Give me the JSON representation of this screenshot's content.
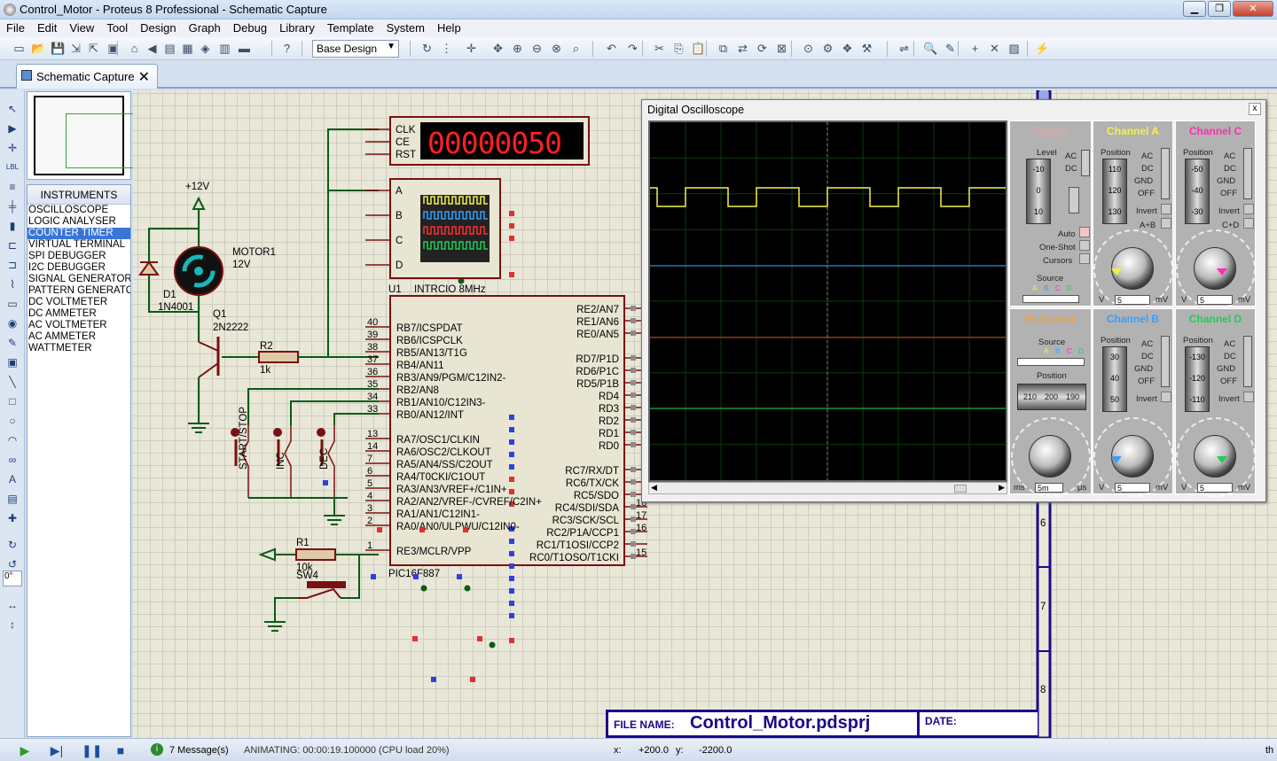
{
  "window": {
    "title": "Control_Motor - Proteus 8 Professional - Schematic Capture"
  },
  "menu": [
    "File",
    "Edit",
    "View",
    "Tool",
    "Design",
    "Graph",
    "Debug",
    "Library",
    "Template",
    "System",
    "Help"
  ],
  "toolbar": {
    "design_select": "Base Design"
  },
  "tab": {
    "label": "Schematic Capture"
  },
  "left_tools": {
    "zoom_value": "0°"
  },
  "instruments": {
    "header": "INSTRUMENTS",
    "items": [
      "OSCILLOSCOPE",
      "LOGIC ANALYSER",
      "COUNTER TIMER",
      "VIRTUAL TERMINAL",
      "SPI DEBUGGER",
      "I2C DEBUGGER",
      "SIGNAL GENERATOR",
      "PATTERN GENERATO",
      "DC VOLTMETER",
      "DC AMMETER",
      "AC VOLTMETER",
      "AC AMMETER",
      "WATTMETER"
    ],
    "selected": "COUNTER TIMER"
  },
  "schematic": {
    "supply": "+12V",
    "motor_ref": "MOTOR1",
    "motor_val": "12V",
    "diode_ref": "D1",
    "diode_val": "1N4001",
    "transistor_ref": "Q1",
    "transistor_val": "2N2222",
    "r2_ref": "R2",
    "r2_val": "1k",
    "r1_ref": "R1",
    "r1_val": "10k",
    "sw4_ref": "SW4",
    "btn_start": "START/STOP",
    "btn_inc": "INC",
    "btn_dec": "DEC",
    "counter_pins": [
      "CLK",
      "CE",
      "RST"
    ],
    "counter_display": "00000050",
    "logic_pins": [
      "A",
      "B",
      "C",
      "D"
    ],
    "mcu_ref": "U1",
    "mcu_clock": "INTRCIO 8MHz",
    "mcu_part": "PIC16F887",
    "mcu_left": [
      {
        "num": "40",
        "name": "RB7/ICSPDAT"
      },
      {
        "num": "39",
        "name": "RB6/ICSPCLK"
      },
      {
        "num": "38",
        "name": "RB5/AN13/T1G"
      },
      {
        "num": "37",
        "name": "RB4/AN11"
      },
      {
        "num": "36",
        "name": "RB3/AN9/PGM/C12IN2-"
      },
      {
        "num": "35",
        "name": "RB2/AN8"
      },
      {
        "num": "34",
        "name": "RB1/AN10/C12IN3-"
      },
      {
        "num": "33",
        "name": "RB0/AN12/INT"
      },
      {
        "num": "13",
        "name": "RA7/OSC1/CLKIN"
      },
      {
        "num": "14",
        "name": "RA6/OSC2/CLKOUT"
      },
      {
        "num": "7",
        "name": "RA5/AN4/SS/C2OUT"
      },
      {
        "num": "6",
        "name": "RA4/T0CKI/C1OUT"
      },
      {
        "num": "5",
        "name": "RA3/AN3/VREF+/C1IN+"
      },
      {
        "num": "4",
        "name": "RA2/AN2/VREF-/CVREF/C2IN+"
      },
      {
        "num": "3",
        "name": "RA1/AN1/C12IN1-"
      },
      {
        "num": "2",
        "name": "RA0/AN0/ULPWU/C12IN0-"
      },
      {
        "num": "1",
        "name": "RE3/MCLR/VPP"
      }
    ],
    "mcu_right": [
      {
        "num": "",
        "name": "RE2/AN7"
      },
      {
        "num": "",
        "name": "RE1/AN6"
      },
      {
        "num": "",
        "name": "RE0/AN5"
      },
      {
        "num": "",
        "name": "RD7/P1D"
      },
      {
        "num": "",
        "name": "RD6/P1C"
      },
      {
        "num": "",
        "name": "RD5/P1B"
      },
      {
        "num": "",
        "name": "RD4"
      },
      {
        "num": "",
        "name": "RD3"
      },
      {
        "num": "",
        "name": "RD2"
      },
      {
        "num": "",
        "name": "RD1"
      },
      {
        "num": "",
        "name": "RD0"
      },
      {
        "num": "",
        "name": "RC7/RX/DT"
      },
      {
        "num": "",
        "name": "RC6/TX/CK"
      },
      {
        "num": "",
        "name": "RC5/SDO"
      },
      {
        "num": "18",
        "name": "RC4/SDI/SDA"
      },
      {
        "num": "17",
        "name": "RC3/SCK/SCL"
      },
      {
        "num": "16",
        "name": "RC2/P1A/CCP1"
      },
      {
        "num": "",
        "name": "RC1/T1OSI/CCP2"
      },
      {
        "num": "15",
        "name": "RC0/T1OSO/T1CKI"
      }
    ],
    "sheet_numbers": [
      "6",
      "7",
      "8"
    ],
    "title_block": {
      "file_label": "FILE NAME:",
      "file_name": "Control_Motor.pdsprj",
      "date_label": "DATE:"
    }
  },
  "oscilloscope": {
    "title": "Digital Oscilloscope",
    "close": "x",
    "trigger": {
      "title": "Trigger",
      "level_label": "Level",
      "level_vals": [
        "-10",
        "0",
        "10"
      ],
      "ac": "AC",
      "dc": "DC",
      "auto": "Auto",
      "one_shot": "One-Shot",
      "cursors": "Cursors",
      "source": "Source",
      "src_letters": [
        "A",
        "B",
        "C",
        "D"
      ]
    },
    "horizontal": {
      "title": "Horizontal",
      "source": "Source",
      "src_letters": [
        "A",
        "B",
        "C",
        "D"
      ],
      "position": "Position",
      "pos_vals": [
        "210",
        "200",
        "190"
      ],
      "unit_left": "ms",
      "unit_right": "μs",
      "value": "5m",
      "scale": [
        "0.5",
        "1",
        "2",
        "5",
        "10",
        "20",
        "50",
        "100",
        "200",
        "0.5"
      ]
    },
    "channels": [
      {
        "id": "a",
        "title": "Channel A",
        "color": "#f2f24a",
        "position": "Position",
        "pos_vals": [
          "110",
          "120",
          "130"
        ],
        "modes": [
          "AC",
          "DC",
          "GND",
          "OFF"
        ],
        "invert": "Invert",
        "extra": "A+B",
        "value": "5",
        "unit_l": "V",
        "unit_r": "mV",
        "scale": [
          "0.5",
          "1",
          "2",
          "5",
          "10",
          "20",
          "2",
          "5",
          "10",
          "20",
          "50",
          "100",
          "200"
        ]
      },
      {
        "id": "c",
        "title": "Channel C",
        "color": "#ff2fb0",
        "position": "Position",
        "pos_vals": [
          "-50",
          "-40",
          "-30"
        ],
        "modes": [
          "AC",
          "DC",
          "GND",
          "OFF"
        ],
        "invert": "Invert",
        "extra": "C+D",
        "value": "5",
        "unit_l": "V",
        "unit_r": "mV",
        "scale": [
          "0.5",
          "1",
          "2",
          "5",
          "10",
          "20",
          "2",
          "5",
          "10",
          "20",
          "50",
          "100",
          "200"
        ]
      },
      {
        "id": "b",
        "title": "Channel B",
        "color": "#33a0ff",
        "position": "Position",
        "pos_vals": [
          "30",
          "40",
          "50"
        ],
        "modes": [
          "AC",
          "DC",
          "GND",
          "OFF"
        ],
        "invert": "Invert",
        "extra": "",
        "value": "5",
        "unit_l": "V",
        "unit_r": "mV",
        "scale": [
          "0.5",
          "1",
          "2",
          "5",
          "10",
          "20",
          "2",
          "5",
          "10",
          "20",
          "50",
          "100",
          "200"
        ]
      },
      {
        "id": "d",
        "title": "Channel D",
        "color": "#22cc55",
        "position": "Position",
        "pos_vals": [
          "-130",
          "-120",
          "-110"
        ],
        "modes": [
          "AC",
          "DC",
          "GND",
          "OFF"
        ],
        "invert": "Invert",
        "extra": "",
        "value": "5",
        "unit_l": "V",
        "unit_r": "mV",
        "scale": [
          "0.5",
          "1",
          "2",
          "5",
          "10",
          "20",
          "2",
          "5",
          "10",
          "20",
          "50",
          "100",
          "200"
        ]
      }
    ]
  },
  "status": {
    "messages": "7 Message(s)",
    "animating": "ANIMATING: 00:00:19.100000 (CPU load 20%)",
    "x_label": "x:",
    "x_value": "+200.0",
    "y_label": "y:",
    "y_value": "-2200.0",
    "units": "th"
  },
  "colors": {
    "wire": "#0a5a18",
    "component": "#7a1010",
    "trace_a": "#f2f24a",
    "trace_b": "#33a0ff",
    "trace_c": "#cc3333",
    "trace_d": "#22cc55"
  }
}
